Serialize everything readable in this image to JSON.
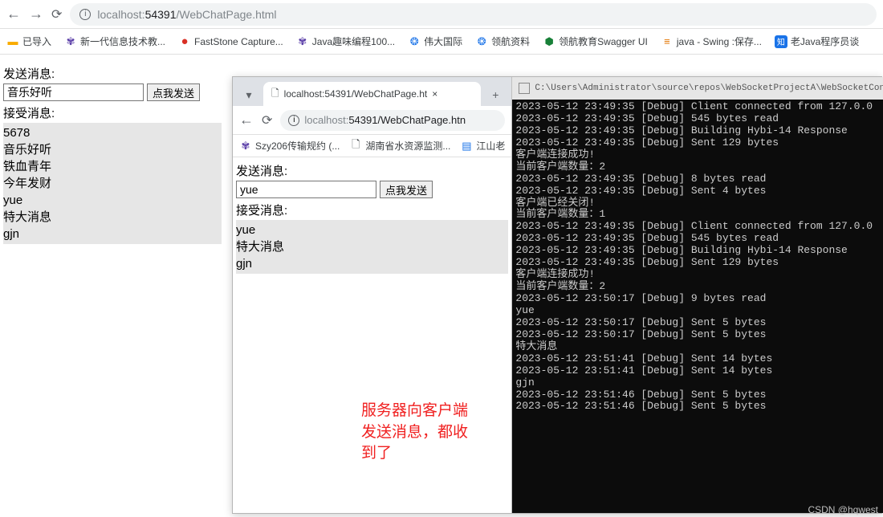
{
  "browser1": {
    "url_host": "localhost:",
    "url_port": "54391",
    "url_path": "/WebChatPage.html",
    "bookmarks": [
      "已导入",
      "新一代信息技术教...",
      "FastStone Capture...",
      "Java趣味编程100...",
      "伟大国际",
      "领航资料",
      "领航教育Swagger UI",
      "java - Swing :保存...",
      "老Java程序员谈"
    ]
  },
  "page1": {
    "send_label": "发送消息:",
    "input_value": "音乐好听",
    "send_btn": "点我发送",
    "recv_label": "接受消息:",
    "messages": [
      "5678",
      "音乐好听",
      "铁血青年",
      "今年发财",
      "yue",
      "特大消息",
      "gjn"
    ]
  },
  "win2": {
    "tab_title": "localhost:54391/WebChatPage.ht",
    "url_host": "localhost:",
    "url_rest": "54391/WebChatPage.htn",
    "bm": [
      "Szy206传输规约 (...",
      "湖南省水资源监测...",
      "江山老"
    ],
    "page": {
      "send_label": "发送消息:",
      "input_value": "yue",
      "send_btn": "点我发送",
      "recv_label": "接受消息:",
      "messages": [
        "yue",
        "特大消息",
        "gjn"
      ]
    },
    "annotation": "服务器向客户端\n发送消息，都收\n到了"
  },
  "console": {
    "title": "C:\\Users\\Administrator\\source\\repos\\WebSocketProjectA\\WebSocketCon",
    "lines": [
      "2023-05-12 23:49:35 [Debug] Client connected from 127.0.0",
      "2023-05-12 23:49:35 [Debug] 545 bytes read",
      "2023-05-12 23:49:35 [Debug] Building Hybi-14 Response",
      "2023-05-12 23:49:35 [Debug] Sent 129 bytes",
      "客户端连接成功!",
      "当前客户端数量：2",
      "2023-05-12 23:49:35 [Debug] 8 bytes read",
      "2023-05-12 23:49:35 [Debug] Sent 4 bytes",
      "客户端已经关闭!",
      "当前客户端数量：1",
      "2023-05-12 23:49:35 [Debug] Client connected from 127.0.0",
      "2023-05-12 23:49:35 [Debug] 545 bytes read",
      "2023-05-12 23:49:35 [Debug] Building Hybi-14 Response",
      "2023-05-12 23:49:35 [Debug] Sent 129 bytes",
      "客户端连接成功!",
      "当前客户端数量：2",
      "2023-05-12 23:50:17 [Debug] 9 bytes read",
      "yue",
      "2023-05-12 23:50:17 [Debug] Sent 5 bytes",
      "2023-05-12 23:50:17 [Debug] Sent 5 bytes",
      "特大消息",
      "2023-05-12 23:51:41 [Debug] Sent 14 bytes",
      "2023-05-12 23:51:41 [Debug] Sent 14 bytes",
      "gjn",
      "2023-05-12 23:51:46 [Debug] Sent 5 bytes",
      "2023-05-12 23:51:46 [Debug] Sent 5 bytes"
    ]
  },
  "watermark": "CSDN @hqwest"
}
